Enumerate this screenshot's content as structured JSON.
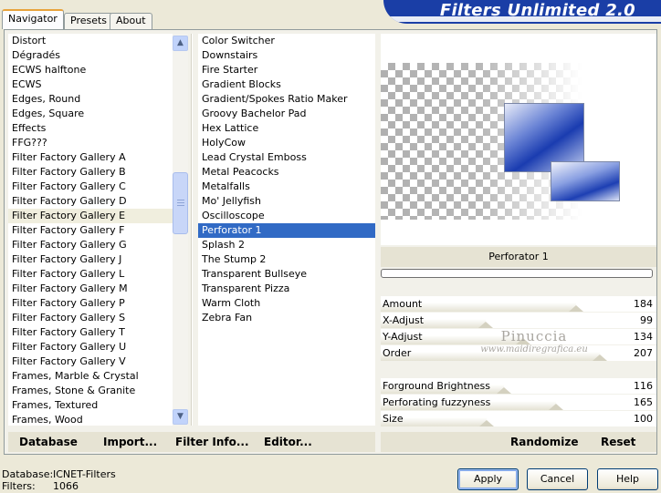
{
  "tabs": [
    "Navigator",
    "Presets",
    "About"
  ],
  "active_tab": 0,
  "banner": {
    "title": "Filters Unlimited 2.0"
  },
  "categories": [
    "Distort",
    "Dégradés",
    "ECWS halftone",
    "ECWS",
    "Edges, Round",
    "Edges, Square",
    "Effects",
    "FFG???",
    "Filter Factory Gallery A",
    "Filter Factory Gallery B",
    "Filter Factory Gallery C",
    "Filter Factory Gallery D",
    "Filter Factory Gallery E",
    "Filter Factory Gallery F",
    "Filter Factory Gallery G",
    "Filter Factory Gallery J",
    "Filter Factory Gallery L",
    "Filter Factory Gallery M",
    "Filter Factory Gallery P",
    "Filter Factory Gallery S",
    "Filter Factory Gallery T",
    "Filter Factory Gallery U",
    "Filter Factory Gallery V",
    "Frames, Marble & Crystal",
    "Frames, Stone & Granite",
    "Frames, Textured",
    "Frames, Wood"
  ],
  "selected_category": "Filter Factory Gallery E",
  "filters": [
    "Color Switcher",
    "Downstairs",
    "Fire Starter",
    "Gradient Blocks",
    "Gradient/Spokes Ratio Maker",
    "Groovy Bachelor Pad",
    "Hex Lattice",
    "HolyCow",
    "Lead Crystal Emboss",
    "Metal Peacocks",
    "Metalfalls",
    "Mo' Jellyfish",
    "Oscilloscope",
    "Perforator 1",
    "Splash 2",
    "The Stump 2",
    "Transparent Bullseye",
    "Transparent Pizza",
    "Warm Cloth",
    "Zebra Fan"
  ],
  "selected_filter": "Perforator 1",
  "bottom_left": {
    "database": "Database",
    "import": "Import...",
    "filter_info": "Filter Info...",
    "editor": "Editor..."
  },
  "bottom_right": {
    "randomize": "Randomize",
    "reset": "Reset"
  },
  "preview": {
    "filter_name": "Perforator 1"
  },
  "sliders": [
    {
      "label": "Amount",
      "value": "184",
      "level": 184
    },
    {
      "label": "X-Adjust",
      "value": "99",
      "level": 99
    },
    {
      "label": "Y-Adjust",
      "value": "134",
      "level": 134
    },
    {
      "label": "Order",
      "value": "207",
      "level": 207
    },
    {
      "label": "",
      "value": "",
      "level": null
    },
    {
      "label": "Forground Brightness",
      "value": "116",
      "level": 116
    },
    {
      "label": "Perforating fuzzyness",
      "value": "165",
      "level": 165
    },
    {
      "label": "Size",
      "value": "100",
      "level": 100
    }
  ],
  "watermark": {
    "line1": "Pinuccia",
    "line2": "www.maidiregrafica.eu"
  },
  "footer": {
    "database_label": "Database:",
    "database_value": "ICNET-Filters",
    "filters_label": "Filters:",
    "filters_value": "1066"
  },
  "buttons": {
    "apply": "Apply",
    "cancel": "Cancel",
    "help": "Help"
  },
  "colors": {
    "selection": "#316ac5",
    "banner": "#1a3ea6",
    "background": "#ece9d8"
  }
}
